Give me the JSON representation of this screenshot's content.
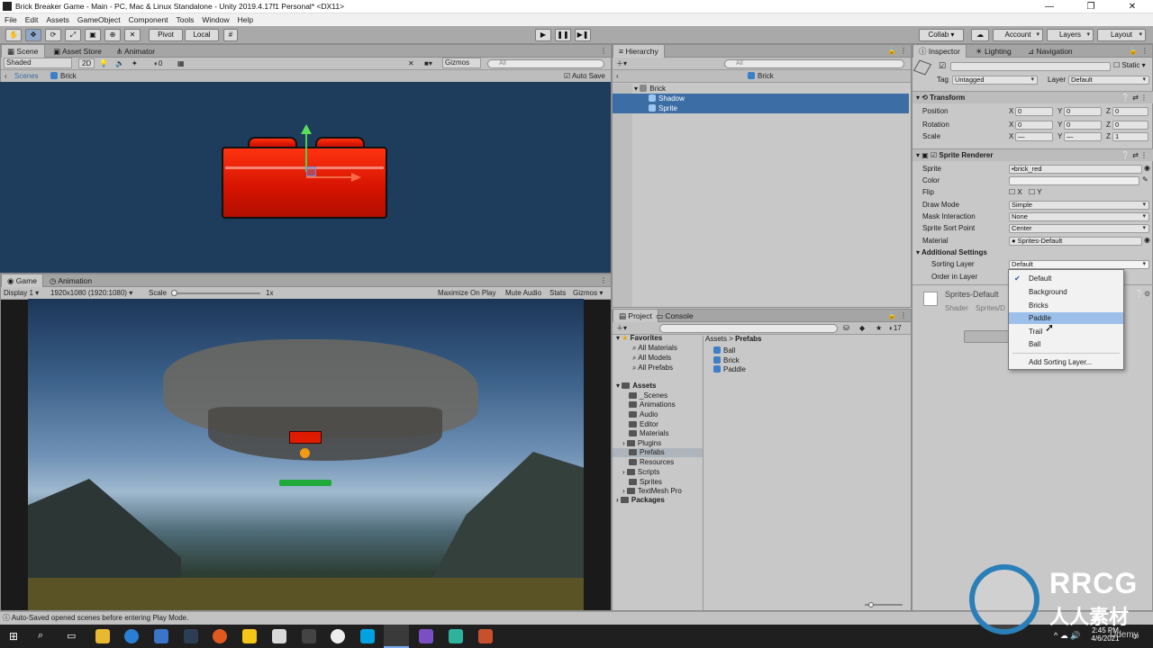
{
  "window": {
    "title": "Brick Breaker Game - Main - PC, Mac & Linux Standalone - Unity 2019.4.17f1 Personal* <DX11>",
    "min": "—",
    "max": "❐",
    "close": "✕"
  },
  "menu": [
    "File",
    "Edit",
    "Assets",
    "GameObject",
    "Component",
    "Tools",
    "Window",
    "Help"
  ],
  "toolbar": {
    "pivot": "Pivot",
    "local": "Local",
    "collab": "Collab ▾",
    "account": "Account",
    "layers": "Layers",
    "layout": "Layout",
    "play": "▶",
    "pause": "❚❚",
    "step": "▶❚"
  },
  "scene": {
    "tabs": [
      "Scene",
      "Asset Store",
      "Animator"
    ],
    "shading": "Shaded",
    "mode2d": "2D",
    "gizmos": "Gizmos",
    "search": "All",
    "breadcrumb_root": "Scenes",
    "breadcrumb_item": "Brick",
    "autosave": "Auto Save"
  },
  "game": {
    "tabs": [
      "Game",
      "Animation"
    ],
    "display": "Display 1",
    "resolution": "1920x1080 (1920:1080)",
    "scale_label": "Scale",
    "scale_value": "1x",
    "maximize": "Maximize On Play",
    "mute": "Mute Audio",
    "stats": "Stats",
    "gizmos": "Gizmos"
  },
  "hierarchy": {
    "tab": "Hierarchy",
    "search": "All",
    "prefab_title": "Brick",
    "items": [
      {
        "label": "Brick"
      },
      {
        "label": "Shadow"
      },
      {
        "label": "Sprite"
      }
    ]
  },
  "project": {
    "tabs": [
      "Project",
      "Console"
    ],
    "badge": "17",
    "favorites_label": "Favorites",
    "favorites": [
      "All Materials",
      "All Models",
      "All Prefabs"
    ],
    "assets_label": "Assets",
    "folders": [
      "_Scenes",
      "Animations",
      "Audio",
      "Editor",
      "Materials",
      "Plugins",
      "Prefabs",
      "Resources",
      "Scripts",
      "Sprites",
      "TextMesh Pro"
    ],
    "packages_label": "Packages",
    "breadcrumb_root": "Assets",
    "breadcrumb_sep": ">",
    "breadcrumb_item": "Prefabs",
    "files": [
      "Ball",
      "Brick",
      "Paddle"
    ]
  },
  "inspector": {
    "tabs": [
      "Inspector",
      "Lighting",
      "Navigation"
    ],
    "static_label": "Static",
    "tag_label": "Tag",
    "tag_value": "Untagged",
    "layer_label": "Layer",
    "layer_value": "Default",
    "transform": {
      "title": "Transform",
      "position_label": "Position",
      "rotation_label": "Rotation",
      "scale_label": "Scale",
      "position": [
        "0",
        "0",
        "0"
      ],
      "rotation": [
        "0",
        "0",
        "0"
      ],
      "scale": [
        "—",
        "—",
        "1"
      ]
    },
    "sprite_renderer": {
      "title": "Sprite Renderer",
      "sprite_label": "Sprite",
      "sprite_value": "brick_red",
      "color_label": "Color",
      "color_value": "#eeeeee",
      "flip_label": "Flip",
      "flip_x": "X",
      "flip_y": "Y",
      "draw_mode_label": "Draw Mode",
      "draw_mode_value": "Simple",
      "mask_label": "Mask Interaction",
      "mask_value": "None",
      "sort_point_label": "Sprite Sort Point",
      "sort_point_value": "Center",
      "material_label": "Material",
      "material_value": "Sprites-Default",
      "additional_label": "Additional Settings",
      "sorting_layer_label": "Sorting Layer",
      "sorting_layer_value": "Default",
      "order_label": "Order in Layer"
    },
    "material_preview": {
      "name": "Sprites-Default",
      "shader_label": "Shader",
      "shader_value": "Sprites/D"
    },
    "add_button_partial": "A"
  },
  "sorting_layer_dropdown": {
    "options": [
      "Default",
      "Background",
      "Bricks",
      "Paddle",
      "Trail",
      "Ball"
    ],
    "checked": "Default",
    "highlighted": "Paddle",
    "add": "Add Sorting Layer..."
  },
  "status": {
    "message": "Auto-Saved opened scenes before entering Play Mode."
  },
  "taskbar": {
    "time": "2:45 PM",
    "date": "4/6/2021"
  },
  "watermark": {
    "brand": "RRCG",
    "sub": "人人素材",
    "udemy": "Udemy"
  },
  "colors": {
    "selection": "#3c6ea5",
    "scene_bg": "#1e3c5c",
    "brick_red": "#d41200",
    "paddle_green": "#1faa3a",
    "ball_orange": "#f29a10"
  }
}
